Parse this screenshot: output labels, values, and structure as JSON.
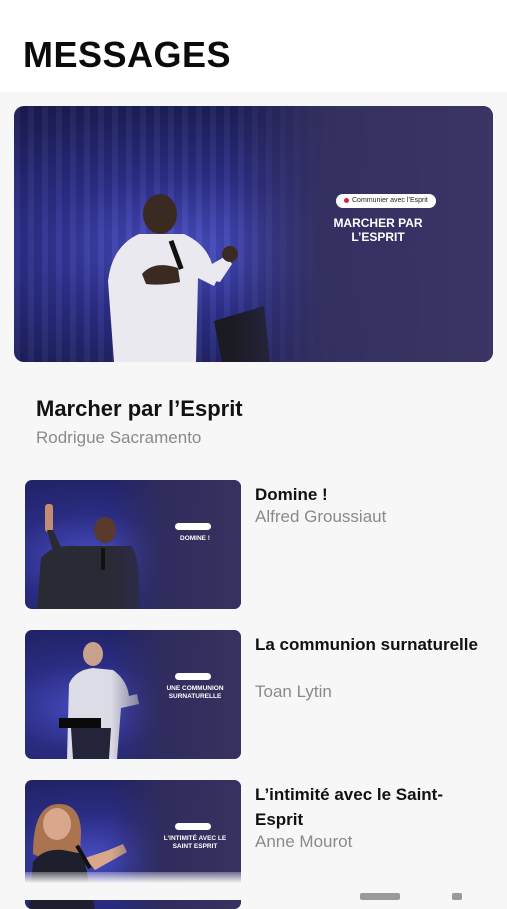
{
  "header": {
    "title": "MESSAGES"
  },
  "featured": {
    "title": "Marcher par l’Esprit",
    "author": "Rodrigue Sacramento",
    "thumbnail": {
      "series_label": "Communier avec l’Esprit",
      "overlay_line1": "MARCHER PAR",
      "overlay_line2": "L’ESPRIT"
    }
  },
  "messages": [
    {
      "title": "Domine !",
      "author": "Alfred Groussiaut",
      "thumbnail": {
        "overlay_line1": "DOMINE !",
        "overlay_line2": ""
      }
    },
    {
      "title": "La communion surnaturelle",
      "author": "Toan Lytin",
      "thumbnail": {
        "overlay_line1": "UNE COMMUNION",
        "overlay_line2": "SURNATURELLE"
      }
    },
    {
      "title": "L’intimité avec le Saint-Esprit",
      "author": "Anne Mourot",
      "thumbnail": {
        "overlay_line1": "L’INTIMITÉ AVEC LE",
        "overlay_line2": "SAINT ESPRIT"
      }
    }
  ],
  "colors": {
    "background": "#f7f7f7",
    "accent_dot": "#d2273c",
    "author_gray": "#8a8a8a",
    "stage_blue": "#2d2f8a"
  }
}
